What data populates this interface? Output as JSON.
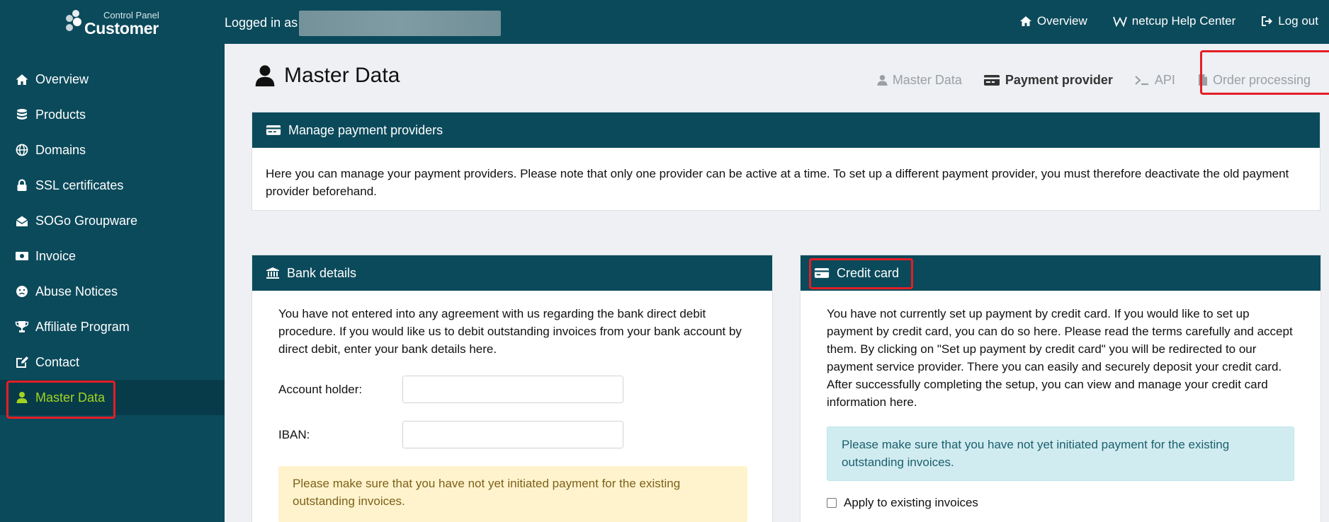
{
  "header": {
    "logo_top": "Control Panel",
    "logo_main": "Customer",
    "logged_in_label": "Logged in as",
    "links": [
      {
        "label": "Overview",
        "icon": "home-icon"
      },
      {
        "label": "netcup Help Center",
        "icon": "wikipedia-w-icon"
      },
      {
        "label": "Log out",
        "icon": "logout-icon"
      }
    ]
  },
  "sidebar": {
    "items": [
      {
        "label": "Overview",
        "icon": "home-icon"
      },
      {
        "label": "Products",
        "icon": "database-icon"
      },
      {
        "label": "Domains",
        "icon": "globe-icon"
      },
      {
        "label": "SSL certificates",
        "icon": "lock-icon"
      },
      {
        "label": "SOGo Groupware",
        "icon": "envelope-open-icon"
      },
      {
        "label": "Invoice",
        "icon": "money-bill-icon"
      },
      {
        "label": "Abuse Notices",
        "icon": "frown-icon"
      },
      {
        "label": "Affiliate Program",
        "icon": "trophy-icon"
      },
      {
        "label": "Contact",
        "icon": "edit-icon"
      },
      {
        "label": "Master Data",
        "icon": "user-icon"
      }
    ],
    "active": "Master Data"
  },
  "page": {
    "title": "Master Data",
    "tabs": [
      {
        "label": "Master Data",
        "icon": "user-icon"
      },
      {
        "label": "Payment provider",
        "icon": "credit-card-icon"
      },
      {
        "label": "API",
        "icon": "terminal-icon"
      },
      {
        "label": "Order processing",
        "icon": "file-icon"
      }
    ],
    "active_tab": "Payment provider"
  },
  "manage": {
    "title": "Manage payment providers",
    "text": "Here you can manage your payment providers. Please note that only one provider can be active at a time. To set up a different payment provider, you must therefore deactivate the old payment provider beforehand."
  },
  "bank": {
    "title": "Bank details",
    "text": "You have not entered into any agreement with us regarding the bank direct debit procedure. If you would like us to debit outstanding invoices from your bank account by direct debit, enter your bank details here.",
    "account_holder_label": "Account holder:",
    "account_holder_value": "",
    "iban_label": "IBAN:",
    "iban_value": "",
    "warning": "Please make sure that you have not yet initiated payment for the existing outstanding invoices."
  },
  "credit_card": {
    "title": "Credit card",
    "text": "You have not currently set up payment by credit card. If you would like to set up payment by credit card, you can do so here. Please read the terms carefully and accept them. By clicking on \"Set up payment by credit card\" you will be redirected to our payment service provider. There you can easily and securely deposit your credit card. After successfully completing the setup, you can view and manage your credit card information here.",
    "info": "Please make sure that you have not yet initiated payment for the existing outstanding invoices.",
    "checkbox_label": "Apply to existing invoices",
    "checkbox_checked": false
  },
  "colors": {
    "brand": "#0b4a5b",
    "active_green": "#a3d321",
    "highlight_red": "#e41e26"
  }
}
